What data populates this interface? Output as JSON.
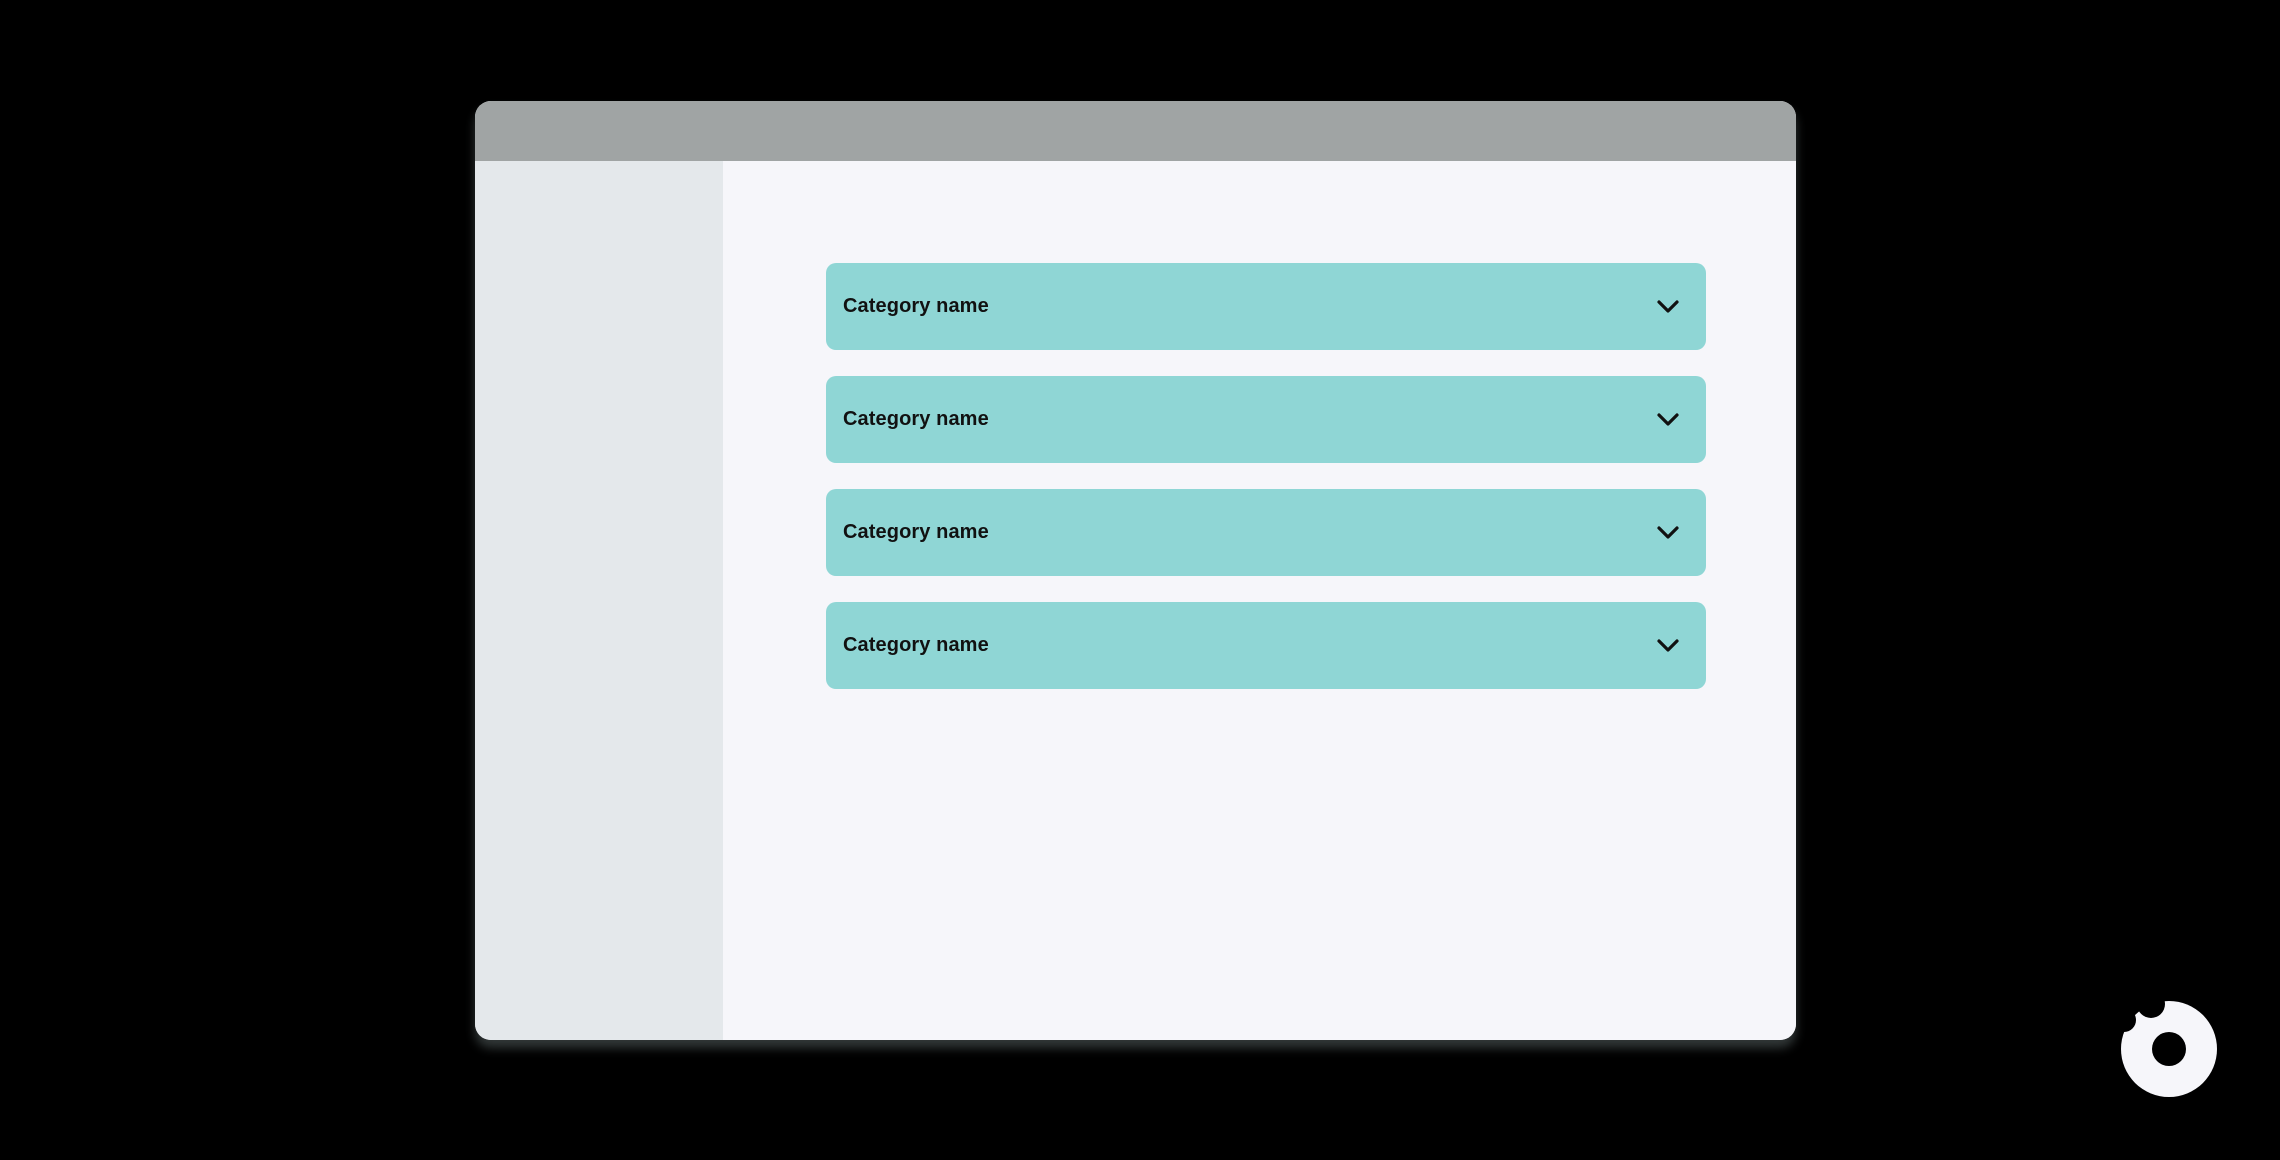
{
  "colors": {
    "background": "#000000",
    "window_bg": "#f6f6fa",
    "titlebar": "#a0a4a4",
    "sidebar": "#e4e8eb",
    "accordion_bg": "#8fd6d5",
    "text": "#111111",
    "logo": "#f6f6fa"
  },
  "accordion": {
    "items": [
      {
        "label": "Category name",
        "icon": "chevron-down-icon"
      },
      {
        "label": "Category name",
        "icon": "chevron-down-icon"
      },
      {
        "label": "Category name",
        "icon": "chevron-down-icon"
      },
      {
        "label": "Category name",
        "icon": "chevron-down-icon"
      }
    ]
  },
  "logo": {
    "icon": "donut-logo-icon"
  }
}
